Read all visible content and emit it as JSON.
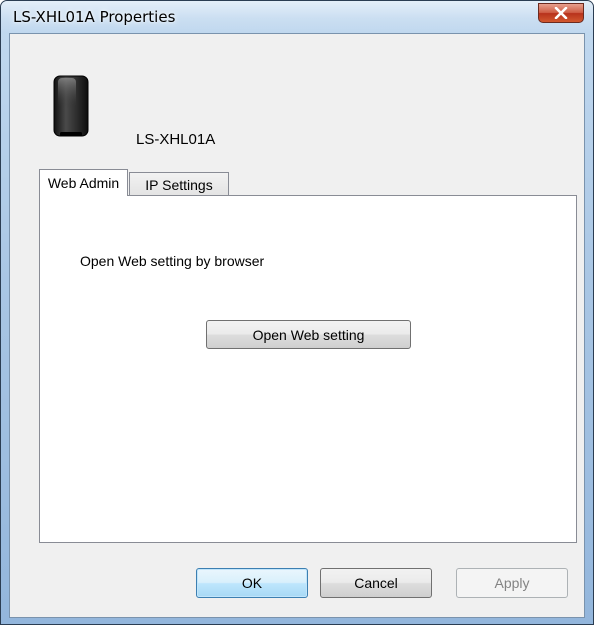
{
  "window": {
    "title": "LS-XHL01A Properties",
    "close_icon": "close-icon"
  },
  "device": {
    "icon": "nas-drive-icon",
    "name": "LS-XHL01A"
  },
  "tabs": [
    {
      "label": "Web Admin",
      "selected": true
    },
    {
      "label": "IP Settings",
      "selected": false
    }
  ],
  "panel": {
    "label": "Open Web setting by browser",
    "open_button_label": "Open Web setting"
  },
  "buttons": {
    "ok_label": "OK",
    "cancel_label": "Cancel",
    "apply_label": "Apply",
    "apply_enabled": false
  },
  "colors": {
    "close_button": "#c9462a",
    "default_button_border": "#3c7fb1",
    "disabled_text": "#838383"
  }
}
